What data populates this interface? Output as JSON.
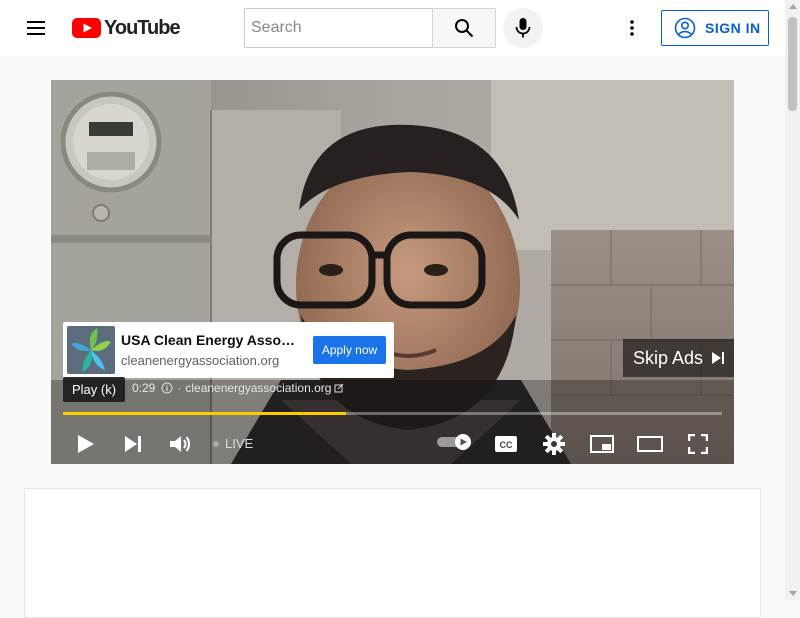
{
  "header": {
    "logo_text": "YouTube",
    "search_placeholder": "Search",
    "sign_in_label": "SIGN IN"
  },
  "player": {
    "ad": {
      "title": "USA Clean Energy Association",
      "url": "cleanenergyassociation.org",
      "cta_label": "Apply now",
      "time": "0:29",
      "meta_url": "cleanenergyassociation.org"
    },
    "skip_label": "Skip Ads",
    "tooltip": "Play (k)",
    "live_label": "LIVE",
    "progress_fraction": 0.43
  },
  "colors": {
    "brand_red": "#ff0000",
    "link_blue": "#065fd4",
    "apply_blue": "#1a73e8",
    "ad_progress": "#ffcc00"
  }
}
